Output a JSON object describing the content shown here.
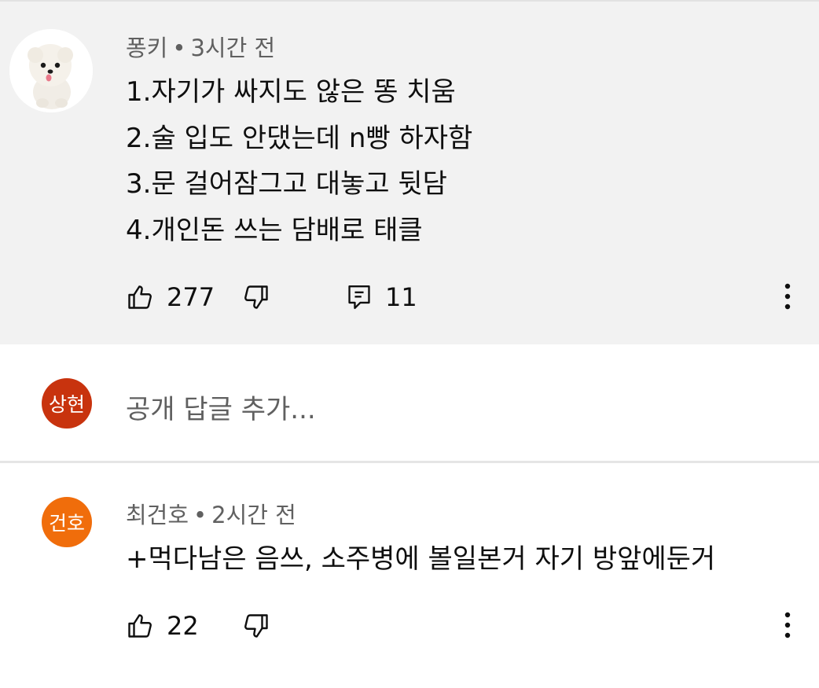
{
  "comment1": {
    "author": "퐁키",
    "separator": "•",
    "time": "3시간 전",
    "avatar_icon": "pomeranian-dog-photo",
    "lines": [
      "1.자기가 싸지도 않은 똥 치움",
      "2.술 입도 안댔는데 n빵 하자함",
      "3.문 걸어잠그고 대놓고 뒷담",
      "4.개인돈 쓰는 담배로 태클"
    ],
    "likes": "277",
    "replies": "11",
    "like_icon": "thumbs-up-icon",
    "dislike_icon": "thumbs-down-icon",
    "reply_icon": "comment-icon",
    "more_icon": "more-vertical-icon",
    "background": "#f2f2f2"
  },
  "reply_input": {
    "avatar_text": "상현",
    "avatar_color": "#c8330e",
    "placeholder": "공개 답글 추가..."
  },
  "comment2": {
    "author": "최건호",
    "separator": "•",
    "time": "2시간 전",
    "avatar_text": "건호",
    "avatar_color": "#f06d0b",
    "text": "+먹다남은 음쓰, 소주병에 볼일본거 자기 방앞에둔거",
    "likes": "22",
    "like_icon": "thumbs-up-icon",
    "dislike_icon": "thumbs-down-icon",
    "more_icon": "more-vertical-icon"
  }
}
